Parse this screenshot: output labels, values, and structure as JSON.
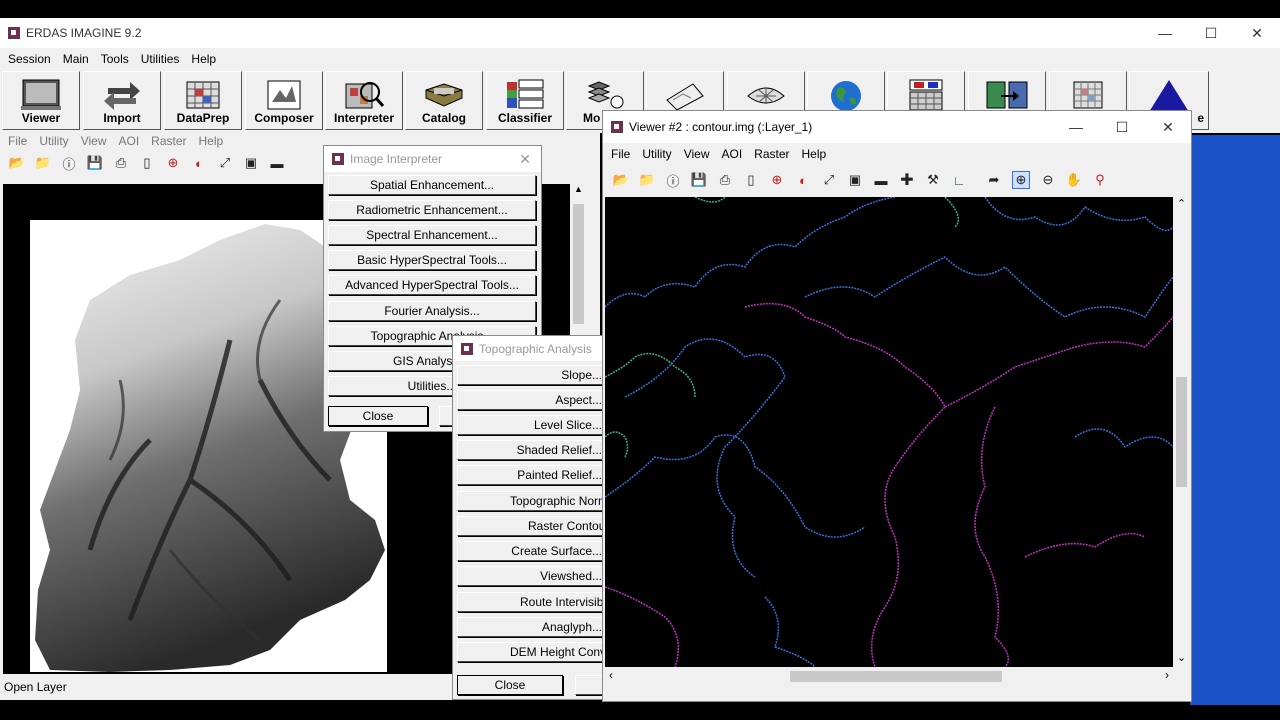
{
  "main_window": {
    "title": "ERDAS IMAGINE 9.2",
    "menu": [
      "Session",
      "Main",
      "Tools",
      "Utilities",
      "Help"
    ],
    "toolbar": [
      {
        "label": "Viewer",
        "icon": "viewer-icon"
      },
      {
        "label": "Import",
        "icon": "import-icon"
      },
      {
        "label": "DataPrep",
        "icon": "dataprep-icon"
      },
      {
        "label": "Composer",
        "icon": "composer-icon"
      },
      {
        "label": "Interpreter",
        "icon": "interpreter-icon"
      },
      {
        "label": "Catalog",
        "icon": "catalog-icon"
      },
      {
        "label": "Classifier",
        "icon": "classifier-icon"
      },
      {
        "label": "Mo",
        "icon": "modeler-icon"
      },
      {
        "label": "",
        "icon": "vector-icon"
      },
      {
        "label": "",
        "icon": "radar-icon"
      },
      {
        "label": "",
        "icon": "globe-icon"
      },
      {
        "label": "",
        "icon": "stereo-icon"
      },
      {
        "label": "",
        "icon": "autosync-icon"
      },
      {
        "label": "",
        "icon": "grid-icon"
      },
      {
        "label": "e",
        "icon": "triangle-icon"
      }
    ]
  },
  "viewer1": {
    "menu": [
      "File",
      "Utility",
      "View",
      "AOI",
      "Raster",
      "Help"
    ],
    "status": "Open Layer"
  },
  "image_interpreter": {
    "title": "Image Interpreter",
    "buttons": [
      "Spatial Enhancement...",
      "Radiometric Enhancement...",
      "Spectral Enhancement...",
      "Basic HyperSpectral Tools...",
      "Advanced HyperSpectral Tools...",
      "Fourier Analysis...",
      "Topographic Analysis...",
      "GIS Analysis...",
      "Utilities..."
    ],
    "close": "Close"
  },
  "topographic_analysis": {
    "title": "Topographic Analysis",
    "buttons": [
      "Slope...",
      "Aspect...",
      "Level Slice...",
      "Shaded Relief...",
      "Painted Relief...",
      "Topographic Normalize...",
      "Raster Contour...",
      "Create Surface...",
      "Viewshed...",
      "Route Intervisibility...",
      "Anaglyph...",
      "DEM Height Converter..."
    ],
    "close": "Close"
  },
  "viewer2": {
    "title": "Viewer #2 : contour.img (:Layer_1)",
    "menu": [
      "File",
      "Utility",
      "View",
      "AOI",
      "Raster",
      "Help"
    ]
  },
  "colors": {
    "contour_blue": "#3a6fd8",
    "contour_magenta": "#c030c0",
    "contour_green": "#30b890",
    "desktop_blue": "#1a52c8"
  }
}
